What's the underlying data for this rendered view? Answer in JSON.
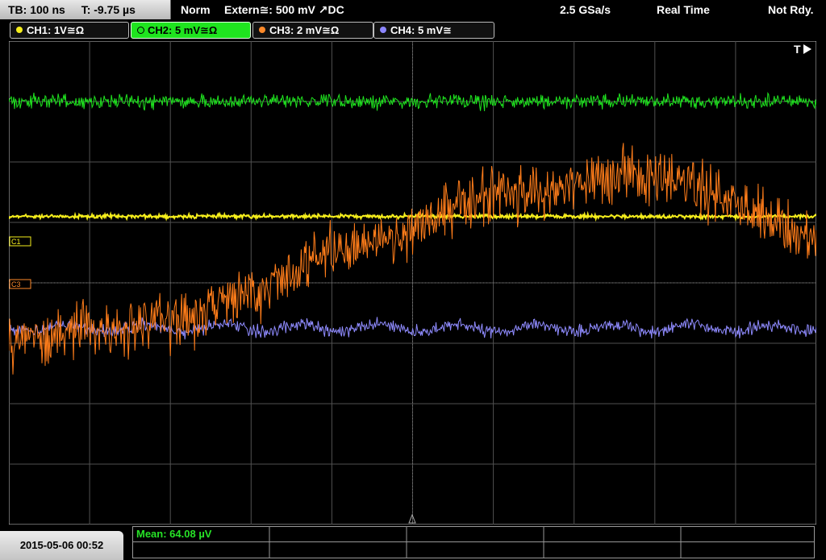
{
  "topbar": {
    "timebase": "TB: 100 ns",
    "trigger_time": "T: -9.75 µs",
    "trigger_mode": "Norm",
    "trigger_source": "Extern≅: 500 mV ↗DC",
    "sample_rate": "2.5 GSa/s",
    "acq_mode": "Real Time",
    "state": "Not Rdy."
  },
  "channels": [
    {
      "label": "CH1: 1V≅Ω",
      "color": "#f5ee1c",
      "active": false
    },
    {
      "label": "CH2: 5 mV≅Ω",
      "color": "#1fe41f",
      "active": true
    },
    {
      "label": "CH3: 2 mV≅Ω",
      "color": "#ff8a2a",
      "active": false
    },
    {
      "label": "CH4: 5 mV≅",
      "color": "#8c86ff",
      "active": false
    }
  ],
  "markers": {
    "c1": "C1",
    "c3": "C3",
    "trigger": "T"
  },
  "colors": {
    "ch1": "#f5ee1c",
    "ch2": "#1fe41f",
    "ch3": "#ff7d1a",
    "ch4": "#8f8bff",
    "grid": "#505050"
  },
  "bottom": {
    "timestamp": "2015-05-06 00:52",
    "measurement": "Mean: 64.08 µV"
  },
  "chart_data": {
    "type": "line",
    "x_divisions": 10,
    "y_divisions": 8,
    "series": [
      {
        "name": "CH1",
        "level_div": 2.9,
        "noise_div": 0.03
      },
      {
        "name": "CH2",
        "level_div": 1.0,
        "noise_div": 0.12
      },
      {
        "name": "CH3",
        "profile": [
          [
            0,
            5.0
          ],
          [
            0.7,
            4.8
          ],
          [
            2.0,
            4.7
          ],
          [
            3.0,
            4.2
          ],
          [
            4.0,
            3.5
          ],
          [
            5.0,
            3.1
          ],
          [
            5.6,
            2.6
          ],
          [
            6.5,
            2.5
          ],
          [
            7.5,
            2.2
          ],
          [
            8.5,
            2.4
          ],
          [
            10,
            3.3
          ]
        ],
        "noise_div": 0.45
      },
      {
        "name": "CH4",
        "level_div": 4.75,
        "noise_div": 0.1
      }
    ]
  }
}
